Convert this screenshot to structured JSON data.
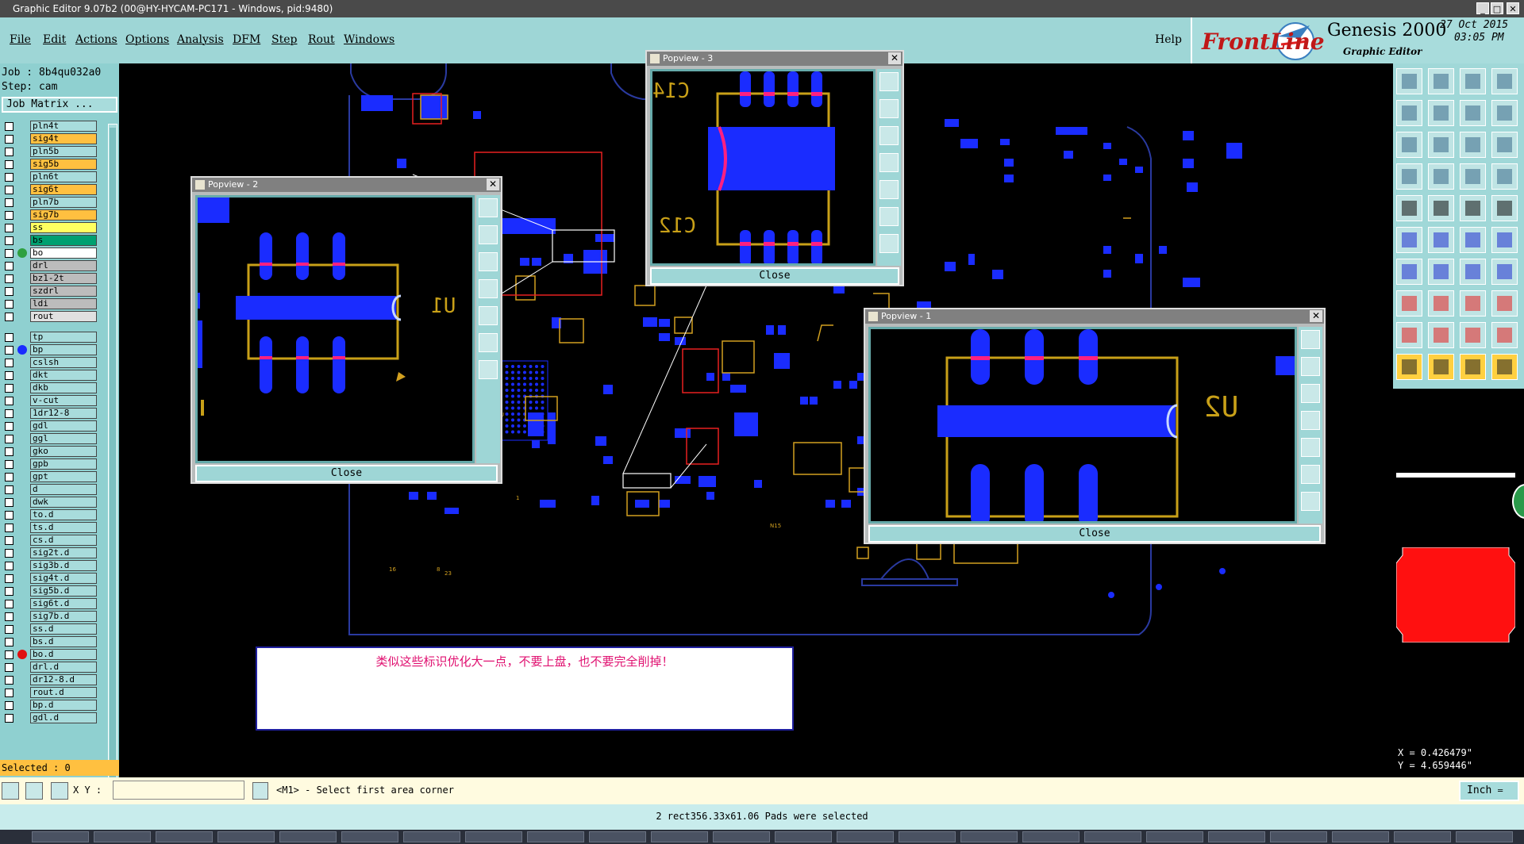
{
  "window": {
    "title": "Graphic Editor 9.07b2 (00@HY-HYCAM-PC171 - Windows, pid:9480)",
    "btn_min": "_",
    "btn_max": "□",
    "btn_close": "✕"
  },
  "menu": {
    "items": [
      "File",
      "Edit",
      "Actions",
      "Options",
      "Analysis",
      "DFM",
      "Step",
      "Rout",
      "Windows"
    ],
    "help": "Help"
  },
  "logo": {
    "brand": "FrontLine",
    "product": "Genesis 2000",
    "subtitle": "Graphic Editor",
    "date": "27 Oct 2015",
    "time": "03:05 PM"
  },
  "left": {
    "job_label": "Job :",
    "job_value": "8b4qu032a0",
    "step_label": "Step:",
    "step_value": "cam",
    "job_matrix": "Job Matrix ...",
    "selected_label": "Selected : 0"
  },
  "layers": [
    {
      "name": "pln4t",
      "color": "#a8dcdc"
    },
    {
      "name": "sig4t",
      "color": "#ffc040"
    },
    {
      "name": "pln5b",
      "color": "#a8dcdc"
    },
    {
      "name": "sig5b",
      "color": "#ffc040"
    },
    {
      "name": "pln6t",
      "color": "#a8dcdc"
    },
    {
      "name": "sig6t",
      "color": "#ffc040"
    },
    {
      "name": "pln7b",
      "color": "#a8dcdc"
    },
    {
      "name": "sig7b",
      "color": "#ffc040"
    },
    {
      "name": "ss",
      "color": "#ffff60"
    },
    {
      "name": "bs",
      "color": "#00a070"
    },
    {
      "name": "bo",
      "color": "#ffffff"
    },
    {
      "name": "drl",
      "color": "#bcbcbc"
    },
    {
      "name": "bz1-2t",
      "color": "#bcbcbc"
    },
    {
      "name": "szdrl",
      "color": "#bcbcbc"
    },
    {
      "name": "ldi",
      "color": "#bcbcbc"
    },
    {
      "name": "rout",
      "color": "#e0e0e0"
    },
    {
      "name": "tp",
      "color": "#a8dcdc"
    },
    {
      "name": "bp",
      "color": "#a8dcdc"
    },
    {
      "name": "cslsh",
      "color": "#a8dcdc"
    },
    {
      "name": "dkt",
      "color": "#a8dcdc"
    },
    {
      "name": "dkb",
      "color": "#a8dcdc"
    },
    {
      "name": "v-cut",
      "color": "#a8dcdc"
    },
    {
      "name": "1dr12-8",
      "color": "#a8dcdc"
    },
    {
      "name": "gdl",
      "color": "#a8dcdc"
    },
    {
      "name": "ggl",
      "color": "#a8dcdc"
    },
    {
      "name": "gko",
      "color": "#a8dcdc"
    },
    {
      "name": "gpb",
      "color": "#a8dcdc"
    },
    {
      "name": "gpt",
      "color": "#a8dcdc"
    },
    {
      "name": "d",
      "color": "#a8dcdc"
    },
    {
      "name": "dwk",
      "color": "#a8dcdc"
    },
    {
      "name": "to.d",
      "color": "#a8dcdc"
    },
    {
      "name": "ts.d",
      "color": "#a8dcdc"
    },
    {
      "name": "cs.d",
      "color": "#a8dcdc"
    },
    {
      "name": "sig2t.d",
      "color": "#a8dcdc"
    },
    {
      "name": "sig3b.d",
      "color": "#a8dcdc"
    },
    {
      "name": "sig4t.d",
      "color": "#a8dcdc"
    },
    {
      "name": "sig5b.d",
      "color": "#a8dcdc"
    },
    {
      "name": "sig6t.d",
      "color": "#a8dcdc"
    },
    {
      "name": "sig7b.d",
      "color": "#a8dcdc"
    },
    {
      "name": "ss.d",
      "color": "#a8dcdc"
    },
    {
      "name": "bs.d",
      "color": "#a8dcdc"
    },
    {
      "name": "bo.d",
      "color": "#a8dcdc"
    },
    {
      "name": "drl.d",
      "color": "#a8dcdc"
    },
    {
      "name": "dr12-8.d",
      "color": "#a8dcdc"
    },
    {
      "name": "rout.d",
      "color": "#a8dcdc"
    },
    {
      "name": "bp.d",
      "color": "#a8dcdc"
    },
    {
      "name": "gdl.d",
      "color": "#a8dcdc"
    }
  ],
  "popups": {
    "p2": {
      "title": "Popview - 2",
      "close": "Close",
      "label": "U1"
    },
    "p3": {
      "title": "Popview - 3",
      "close": "Close",
      "label_top": "C14",
      "label_bottom": "C12"
    },
    "p1": {
      "title": "Popview - 1",
      "close": "Close",
      "label": "U2"
    }
  },
  "annotation": {
    "text": "类似这些标识优化大一点，不要上盘，也不要完全削掉！"
  },
  "status": {
    "xy_label": "X Y :",
    "xy_value": "",
    "prompt": "<M1> - Select first area corner",
    "units": "Inch",
    "message": "2 rect356.33x61.06 Pads were selected",
    "coord_x": "X = 0.426479\"",
    "coord_y": "Y = 4.659446\""
  },
  "icons": {
    "popup_tools": [
      "zoom-home-icon",
      "zoom-in-icon",
      "zoom-out-icon",
      "pan-icon",
      "fit-icon",
      "center-icon",
      "move-icon"
    ]
  }
}
